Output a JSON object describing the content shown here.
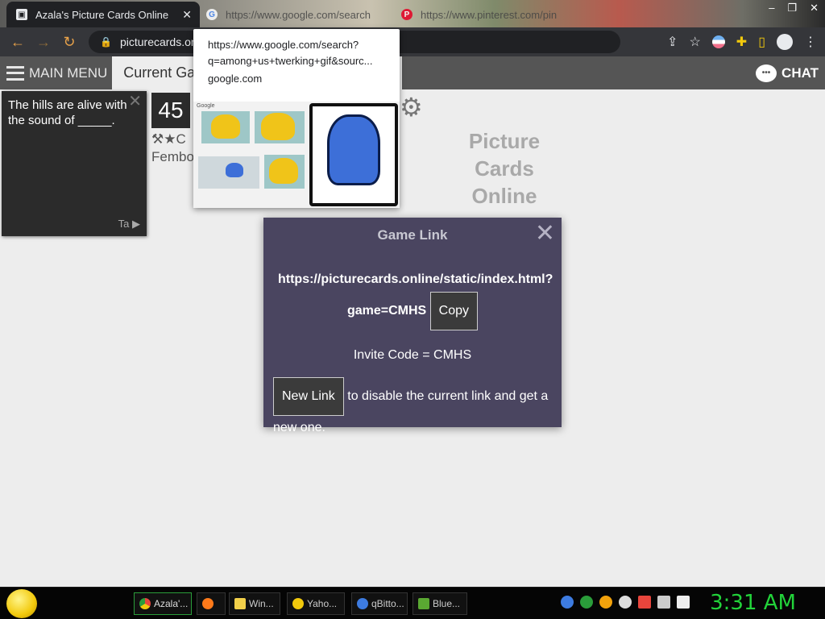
{
  "browser": {
    "tabs": [
      {
        "title": "Azala's Picture Cards Online",
        "active": true
      },
      {
        "title": "https://www.google.com/search",
        "active": false
      },
      {
        "title": "https://www.pinterest.com/pin",
        "active": false
      }
    ],
    "address": "picturecards.onl",
    "hover_preview": {
      "url_line1": "https://www.google.com/search?",
      "url_line2": "q=among+us+twerking+gif&sourc...",
      "domain": "google.com",
      "thumb_brand": "Google"
    }
  },
  "app": {
    "main_menu_label": "MAIN MENU",
    "current_game_label": "Current Gam",
    "chat_label": "CHAT",
    "black_card": {
      "text": "The hills are alive with the sound of _____.",
      "footer": "Ta"
    },
    "score": "45",
    "player_line1": "⚒★C",
    "player_line2": "Fembo",
    "logo_lines": [
      "Picture",
      "Cards",
      "Online"
    ]
  },
  "modal": {
    "title": "Game Link",
    "link_part1": "https://picturecards.online/static/index.html?",
    "link_part2": "game=CMHS",
    "copy_label": "Copy",
    "invite_text": "Invite Code = CMHS",
    "new_link_label": "New Link",
    "new_link_desc": "to disable the current link and get a new one."
  },
  "taskbar": {
    "items": [
      {
        "label": "Azala'...",
        "color": "#e8453c",
        "active": true
      },
      {
        "label": "",
        "color": "#ff7a1a",
        "active": false
      },
      {
        "label": "Win...",
        "color": "#f2d04a",
        "active": false
      },
      {
        "label": "Yaho...",
        "color": "#f2c90c",
        "active": false
      },
      {
        "label": "qBitto...",
        "color": "#3d7be0",
        "active": false
      },
      {
        "label": "Blue...",
        "color": "#5aa832",
        "active": false
      }
    ],
    "clock": "3:31 AM"
  }
}
